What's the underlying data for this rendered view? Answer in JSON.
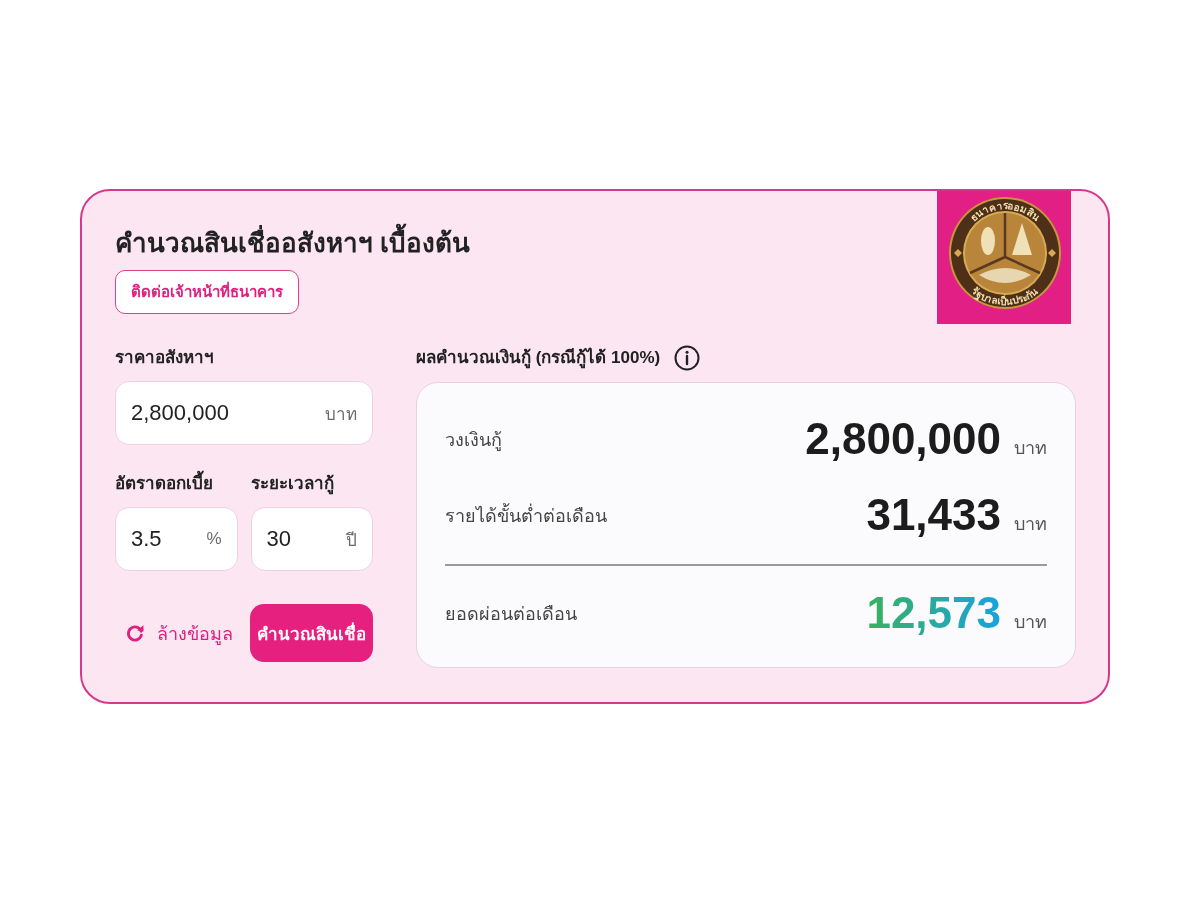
{
  "header": {
    "title": "คำนวณสินเชื่ออสังหาฯ เบื้องต้น",
    "contact_button": "ติดต่อเจ้าหน้าที่ธนาคาร"
  },
  "logo": {
    "top_text": "ธนาคารออมสิน",
    "bottom_text": "รัฐบาลเป็นประกัน"
  },
  "form": {
    "field_rows": [
      {
        "fields": [
          {
            "label": "ราคาอสังหาฯ",
            "value": "2,800,000",
            "unit": "บาท"
          }
        ]
      },
      {
        "fields": [
          {
            "label": "อัตราดอกเบี้ย",
            "value": "3.5",
            "unit": "%"
          },
          {
            "label": "ระยะเวลากู้",
            "value": "30",
            "unit": "ปี"
          }
        ]
      }
    ],
    "reset_button": "ล้างข้อมูล",
    "calculate_button": "คำนวณสินเชื่อ"
  },
  "results": {
    "title": "ผลคำนวณเงินกู้ (กรณีกู้ได้ 100%)",
    "rows": [
      {
        "kind": "figure",
        "label": "วงเงินกู้",
        "value": "2,800,000",
        "unit": "บาท"
      },
      {
        "kind": "figure",
        "label": "รายได้ขั้นต่ำต่อเดือน",
        "value": "31,433",
        "unit": "บาท"
      },
      {
        "kind": "total",
        "label": "ยอดผ่อนต่อเดือน",
        "value": "12,573",
        "unit": "บาท"
      }
    ]
  }
}
